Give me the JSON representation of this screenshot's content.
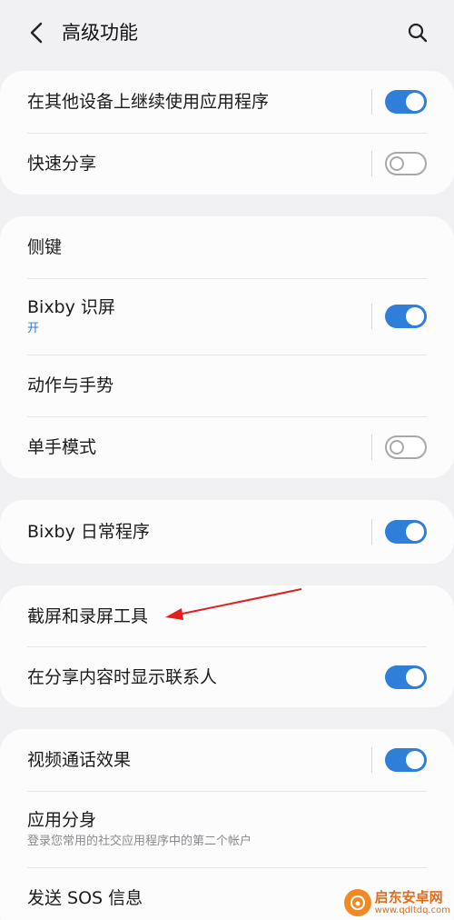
{
  "header": {
    "title": "高级功能"
  },
  "group1": {
    "continue_apps": {
      "label": "在其他设备上继续使用应用程序",
      "toggle": "on"
    },
    "quick_share": {
      "label": "快速分享",
      "toggle": "off"
    }
  },
  "group2": {
    "side_key": {
      "label": "侧键"
    },
    "bixby_vision": {
      "label": "Bixby 识屏",
      "sub": "开",
      "toggle": "on"
    },
    "motions": {
      "label": "动作与手势"
    },
    "one_hand": {
      "label": "单手模式",
      "toggle": "off"
    }
  },
  "group3": {
    "bixby_routines": {
      "label": "Bixby 日常程序",
      "toggle": "on"
    }
  },
  "group4": {
    "screenshot_tools": {
      "label": "截屏和录屏工具"
    },
    "share_contacts": {
      "label": "在分享内容时显示联系人",
      "toggle": "on"
    }
  },
  "group5": {
    "video_call": {
      "label": "视频通话效果",
      "toggle": "on"
    },
    "dual_apps": {
      "label": "应用分身",
      "sub": "登录您常用的社交应用程序中的第二个帐户"
    },
    "sos": {
      "label": "发送 SOS 信息"
    }
  },
  "watermark": {
    "name": "启东安卓网",
    "url": "www.qdltdq.com"
  },
  "colors": {
    "accent": "#2f7fd9",
    "background": "#f1f1f3",
    "card": "#fcfcfd",
    "annotation_arrow": "#e02020"
  },
  "icons": {
    "back": "chevron-left-icon",
    "search": "search-icon"
  }
}
